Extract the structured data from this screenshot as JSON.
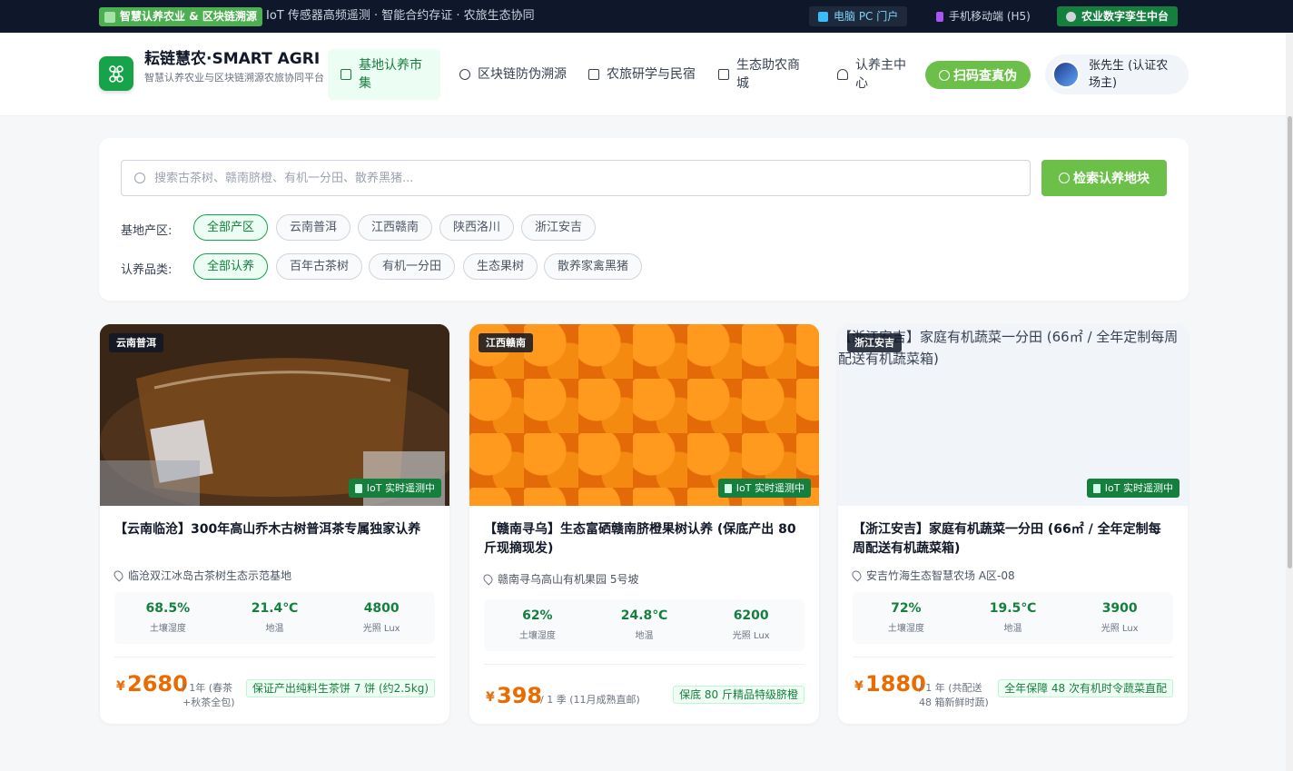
{
  "topbar": {
    "badge": "智慧认养农业 & 区块链溯源",
    "ticker": "IoT 传感器高频遥测 · 智能合约存证 · 农旅生态协同",
    "pc_portal": "电脑 PC 门户",
    "mobile": "手机移动端 (H5)",
    "twin": "农业数字孪生中台"
  },
  "header": {
    "brand_title": "耘链慧农·SMART AGRI",
    "brand_subtitle": "智慧认养农业与区块链溯源农旅协同平台",
    "nav": [
      {
        "label": "基地认养市集"
      },
      {
        "label": "区块链防伪溯源"
      },
      {
        "label": "农旅研学与民宿"
      },
      {
        "label": "生态助农商城"
      },
      {
        "label": "认养主中心"
      }
    ],
    "scan_button": "扫码查真伪",
    "user_name": "张先生 (认证农场主)"
  },
  "search": {
    "placeholder": "搜索古茶树、赣南脐橙、有机一分田、散养黑猪...",
    "button": "检索认养地块",
    "region_label": "基地产区:",
    "regions": [
      "全部产区",
      "云南普洱",
      "江西赣南",
      "陕西洛川",
      "浙江安吉"
    ],
    "category_label": "认养品类:",
    "categories": [
      "全部认养",
      "百年古茶树",
      "有机一分田",
      "生态果树",
      "散养家禽黑猪"
    ]
  },
  "cards": [
    {
      "region": "云南普洱",
      "iot": "IoT 实时遥测中",
      "title": "【云南临沧】300年高山乔木古树普洱茶专属独家认养",
      "location": "临沧双江冰岛古茶树生态示范基地",
      "metrics": [
        {
          "value": "68.5%",
          "label": "土壤湿度"
        },
        {
          "value": "21.4℃",
          "label": "地温"
        },
        {
          "value": "4800",
          "label": "光照 Lux"
        }
      ],
      "currency": "¥",
      "price": "2680",
      "unit": "/ 1年 (春茶+秋茶全包)",
      "guarantee": "保证产出纯料生茶饼 7 饼 (约2.5kg)"
    },
    {
      "region": "江西赣南",
      "iot": "IoT 实时遥测中",
      "title": "【赣南寻乌】生态富硒赣南脐橙果树认养 (保底产出 80 斤现摘现发)",
      "location": "赣南寻乌高山有机果园 5号坡",
      "metrics": [
        {
          "value": "62%",
          "label": "土壤湿度"
        },
        {
          "value": "24.8℃",
          "label": "地温"
        },
        {
          "value": "6200",
          "label": "光照 Lux"
        }
      ],
      "currency": "¥",
      "price": "398",
      "unit": "/ 1 季 (11月成熟直邮)",
      "guarantee": "保底 80 斤精品特级脐橙"
    },
    {
      "region": "浙江安吉",
      "iot": "IoT 实时遥测中",
      "image_alt": "【浙江安吉】家庭有机蔬菜一分田 (66㎡ / 全年定制每周配送有机蔬菜箱)",
      "title": "【浙江安吉】家庭有机蔬菜一分田 (66㎡ / 全年定制每周配送有机蔬菜箱)",
      "location": "安吉竹海生态智慧农场 A区-08",
      "metrics": [
        {
          "value": "72%",
          "label": "土壤湿度"
        },
        {
          "value": "19.5℃",
          "label": "地温"
        },
        {
          "value": "3900",
          "label": "光照 Lux"
        }
      ],
      "currency": "¥",
      "price": "1880",
      "unit": "/ 1 年 (共配送 48 箱新鲜时蔬)",
      "guarantee": "全年保障 48 次有机时令蔬菜直配"
    }
  ]
}
